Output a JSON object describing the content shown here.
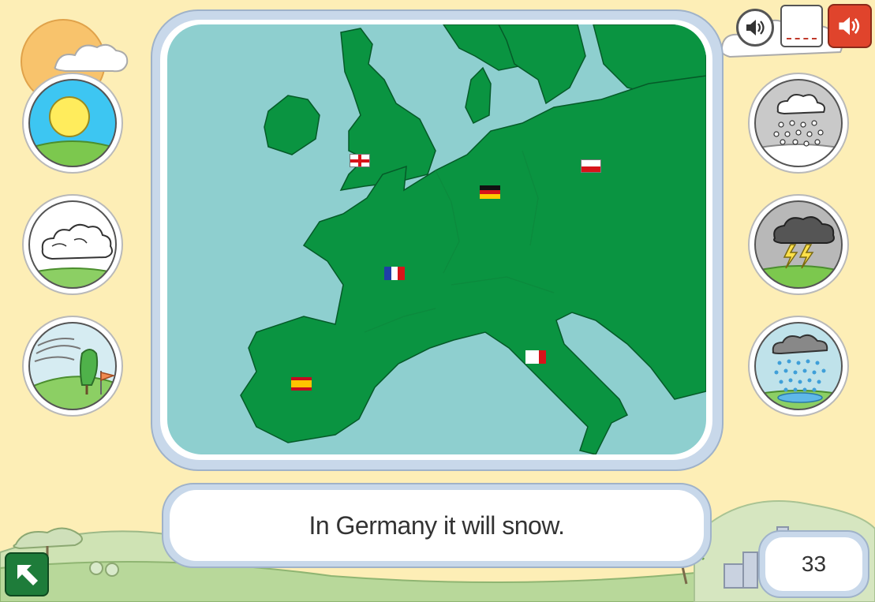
{
  "sentence": "In Germany it will snow.",
  "counter": "33",
  "weather_left": [
    "sunny",
    "cloudy",
    "windy"
  ],
  "weather_right": [
    "snowy",
    "stormy",
    "rainy"
  ],
  "flags": [
    "england",
    "germany",
    "poland",
    "france",
    "spain",
    "italy"
  ],
  "icons": {
    "sound_small": "speaker-icon",
    "sound_big": "speaker-icon",
    "back": "arrow-up-left-icon"
  },
  "colors": {
    "background": "#fdeeb6",
    "land": "#0a9441",
    "sea": "#8ecfcf",
    "frame": "#c8d8ea",
    "sound_active": "#e0442c",
    "back_button": "#1e7c3a"
  }
}
